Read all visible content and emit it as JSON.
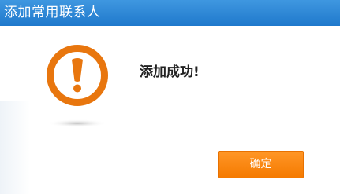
{
  "title_bar": {
    "title": "添加常用联系人",
    "color": "#2a86d6"
  },
  "alert": {
    "icon": "exclamation-circle-icon",
    "color": "#e8760e",
    "message": "添加成功!"
  },
  "buttons": {
    "ok_label": "确定",
    "ok_color": "#fa8a11"
  }
}
